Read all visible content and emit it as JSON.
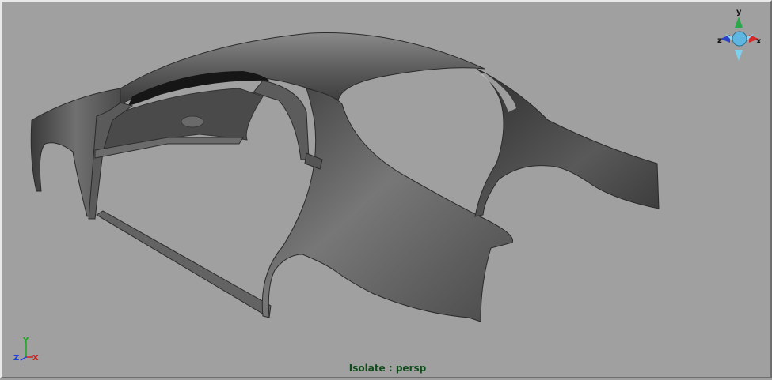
{
  "viewport": {
    "status": "Isolate : persp",
    "model_icon": "car-body-shell-model"
  },
  "view_cube": {
    "icon": "view-cube-icon",
    "axis_y": "y",
    "axis_x": "x",
    "axis_z": "z"
  },
  "axis_indicator": {
    "icon": "axis-indicator-icon",
    "axis_y": "Y",
    "axis_x": "X",
    "axis_z": "Z"
  },
  "colors": {
    "background": "#a0a0a0",
    "status_text": "#0e4d1a",
    "axis_y": "#19a81f",
    "axis_x": "#d41a1a",
    "axis_z": "#1a3fd4",
    "cube_center": "#5fb6e0"
  }
}
